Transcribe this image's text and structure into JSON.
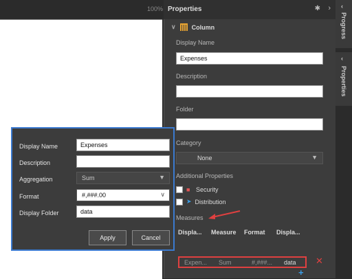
{
  "canvas": {
    "zoom_text": "100%"
  },
  "properties": {
    "title": "Properties",
    "section": "Column",
    "display_name_label": "Display Name",
    "display_name_value": "Expenses",
    "description_label": "Description",
    "description_value": "",
    "folder_label": "Folder",
    "folder_value": "",
    "category_label": "Category",
    "category_value": "None",
    "additional_label": "Additional Properties",
    "security_label": "Security",
    "distribution_label": "Distribution",
    "measures_label": "Measures",
    "measures_columns": [
      "Displa...",
      "Measure",
      "Format",
      "Displa..."
    ],
    "measures_rows": [
      [
        "Expen...",
        "Sum",
        "#,###...",
        "data"
      ]
    ]
  },
  "right_rail": {
    "progress_label": "Progress",
    "properties_label": "Properties"
  },
  "dialog": {
    "display_name_label": "Display Name",
    "display_name_value": "Expenses",
    "description_label": "Description",
    "description_value": "",
    "aggregation_label": "Aggregation",
    "aggregation_value": "Sum",
    "format_label": "Format",
    "format_value": "#,###.00",
    "display_folder_label": "Display Folder",
    "display_folder_value": "data",
    "apply_label": "Apply",
    "cancel_label": "Cancel"
  },
  "colors": {
    "highlight_red": "#e04040",
    "dialog_border": "#3b7ad0",
    "accent_blue": "#3a9ee8"
  }
}
